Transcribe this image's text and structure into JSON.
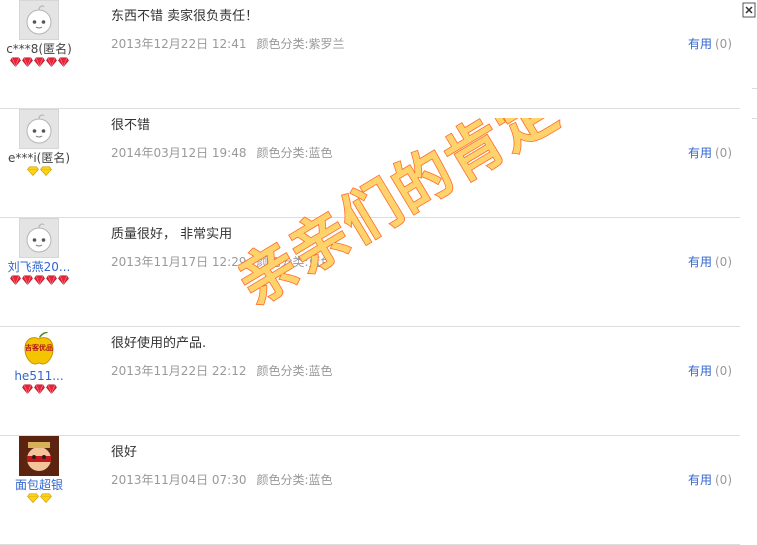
{
  "reviews": [
    {
      "user": "c***8(匿名)",
      "user_is_link": false,
      "avatar": "default-baby-avatar",
      "rank_icon": "red-heart-gem",
      "rank_count": 5,
      "content": "东西不错 卖家很负责任！",
      "date": "2013年12月22日 12:41",
      "sku": "颜色分类:紫罗兰",
      "useful_label": "有用",
      "useful_count": "(0)"
    },
    {
      "user": "e***i(匿名)",
      "user_is_link": false,
      "avatar": "default-baby-avatar",
      "rank_icon": "yellow-diamond",
      "rank_count": 2,
      "content": "很不错",
      "date": "2014年03月12日 19:48",
      "sku": "颜色分类:蓝色",
      "useful_label": "有用",
      "useful_count": "(0)"
    },
    {
      "user": "刘飞燕20...",
      "user_is_link": true,
      "avatar": "default-baby-avatar",
      "rank_icon": "red-heart-gem",
      "rank_count": 5,
      "content": "质量很好， 非常实用",
      "date": "2013年11月17日 12:29",
      "sku": "颜色分类:蓝色",
      "useful_label": "有用",
      "useful_count": "(0)"
    },
    {
      "user": "he511...",
      "user_is_link": true,
      "avatar": "apple-shop-logo",
      "avatar_text": "吉客优品",
      "rank_icon": "red-heart-gem",
      "rank_count": 3,
      "content": "很好使用的产品.",
      "date": "2013年11月22日 22:12",
      "sku": "颜色分类:蓝色",
      "useful_label": "有用",
      "useful_count": "(0)"
    },
    {
      "user": "面包超银",
      "user_is_link": true,
      "avatar": "cartoon-character-avatar",
      "rank_icon": "yellow-diamond",
      "rank_count": 2,
      "content": "很好",
      "date": "2013年11月04日 07:30",
      "sku": "颜色分类:蓝色",
      "useful_label": "有用",
      "useful_count": "(0)"
    }
  ],
  "watermark": "亲亲们的肯定",
  "colors": {
    "link": "#3366cc",
    "meta": "#999999",
    "divider": "#dddddd",
    "watermark_fill": "#ffd36b",
    "watermark_stroke": "#ff6a2b"
  }
}
